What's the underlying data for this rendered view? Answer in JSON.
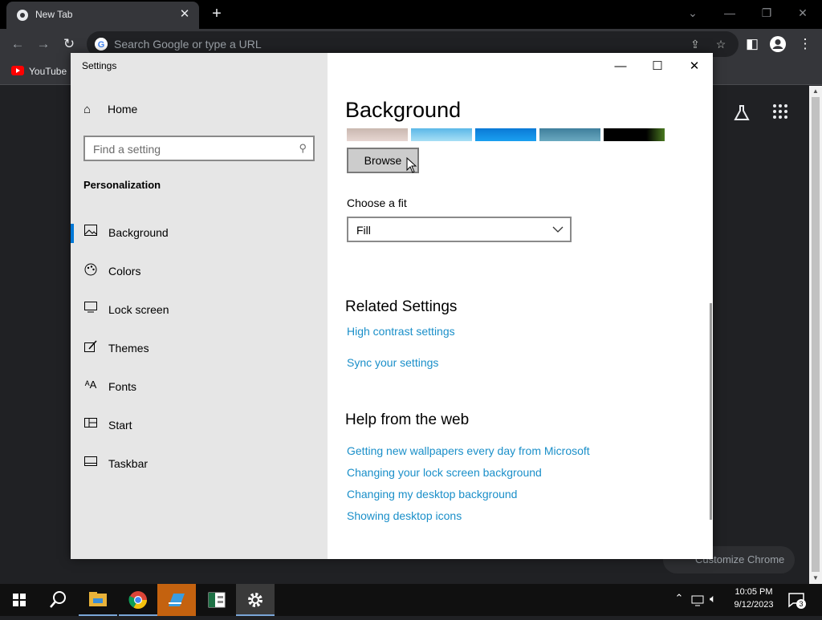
{
  "chrome": {
    "tab_title": "New Tab",
    "tab_close": "✕",
    "new_tab": "+",
    "omnibox_placeholder": "Search Google or type a URL",
    "bookmark_youtube": "YouTube",
    "customize_label": "Customize Chrome"
  },
  "settings": {
    "window_title": "Settings",
    "nav": {
      "home_label": "Home",
      "search_placeholder": "Find a setting",
      "section_title": "Personalization",
      "items": [
        {
          "label": "Background",
          "icon": "picture-icon"
        },
        {
          "label": "Colors",
          "icon": "palette-icon"
        },
        {
          "label": "Lock screen",
          "icon": "lock-screen-icon"
        },
        {
          "label": "Themes",
          "icon": "themes-icon"
        },
        {
          "label": "Fonts",
          "icon": "fonts-icon"
        },
        {
          "label": "Start",
          "icon": "start-icon"
        },
        {
          "label": "Taskbar",
          "icon": "taskbar-icon"
        }
      ]
    },
    "content": {
      "page_title": "Background",
      "browse_label": "Browse",
      "fit_label": "Choose a fit",
      "fit_value": "Fill",
      "related_title": "Related Settings",
      "related_links": [
        "High contrast settings",
        "Sync your settings"
      ],
      "help_title": "Help from the web",
      "help_links": [
        "Getting new wallpapers every day from Microsoft",
        "Changing your lock screen background",
        "Changing my desktop background",
        "Showing desktop icons"
      ]
    }
  },
  "taskbar": {
    "time": "10:05 PM",
    "date": "9/12/2023",
    "notification_count": "3"
  },
  "colors": {
    "accent": "#0078d7",
    "link": "#1a8fc9",
    "taskbar_bg": "#101010"
  }
}
